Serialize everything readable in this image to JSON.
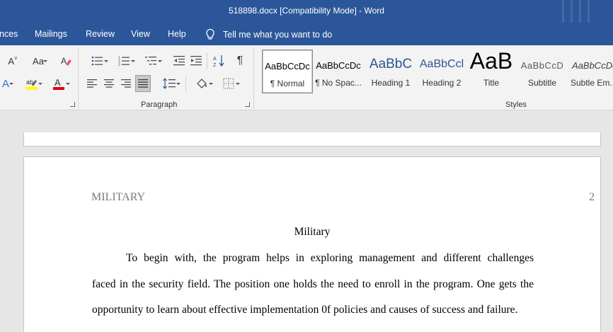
{
  "window": {
    "title": "518898.docx [Compatibility Mode]  -  Word"
  },
  "menu": {
    "items": [
      "nces",
      "Mailings",
      "Review",
      "View",
      "Help"
    ],
    "tell_me": "Tell me what you want to do"
  },
  "ribbon": {
    "groups": {
      "paragraph": "Paragraph",
      "styles": "Styles"
    },
    "font_size_label": "Aa"
  },
  "styles": [
    {
      "preview": "AaBbCcDc",
      "name": "¶ Normal"
    },
    {
      "preview": "AaBbCcDc",
      "name": "¶ No Spac..."
    },
    {
      "preview": "AaBbC",
      "name": "Heading 1"
    },
    {
      "preview": "AaBbCcl",
      "name": "Heading 2"
    },
    {
      "preview": "AaB",
      "name": "Title"
    },
    {
      "preview": "AaBbCcD",
      "name": "Subtitle"
    },
    {
      "preview": "AaBbCcDc",
      "name": "Subtle Em..."
    }
  ],
  "document": {
    "header_left": "MILITARY",
    "page_number": "2",
    "title": "Military",
    "lines": [
      "To begin with, the program helps in exploring management and different challenges",
      "faced in the security field. The position one holds the need to enroll in the program. One gets the",
      "opportunity to learn about effective implementation 0f policies and causes of success and failure."
    ]
  },
  "colors": {
    "titlebar": "#2b579a",
    "ribbon": "#f3f3f3",
    "highlight_yellow": "#ffff00",
    "font_color_red": "#e00000"
  }
}
